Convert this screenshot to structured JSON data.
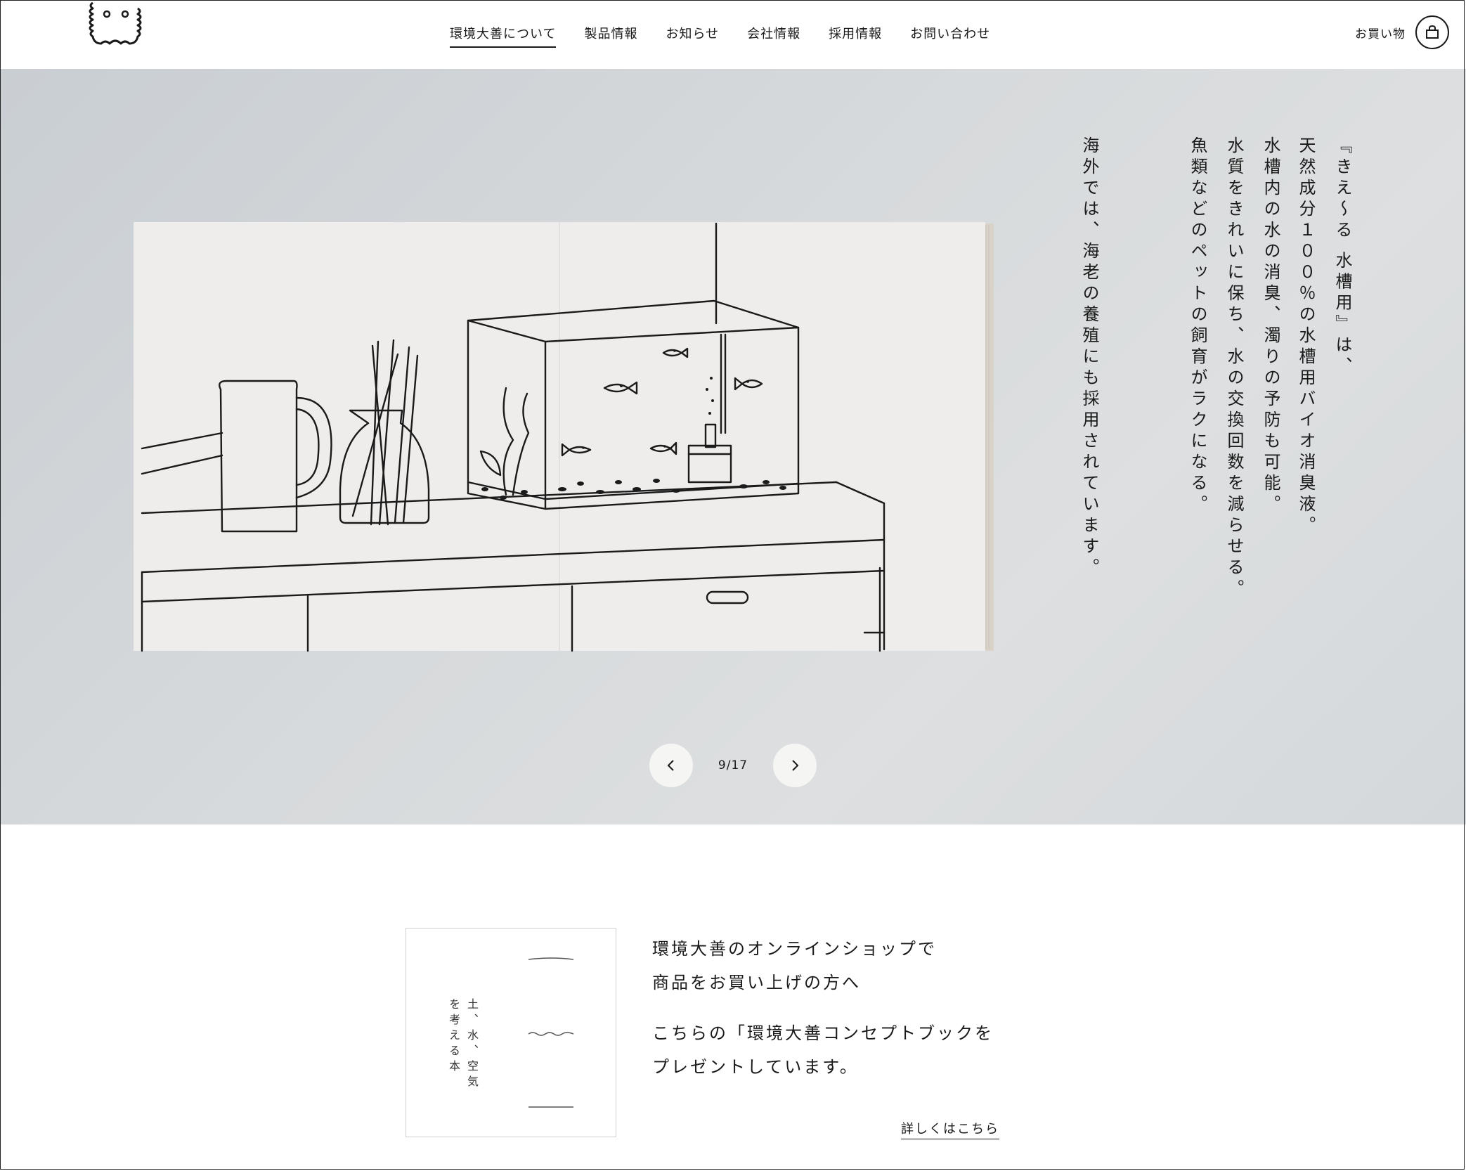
{
  "header": {
    "nav": [
      {
        "label": "環境大善について",
        "active": true
      },
      {
        "label": "製品情報"
      },
      {
        "label": "お知らせ"
      },
      {
        "label": "会社情報"
      },
      {
        "label": "採用情報"
      },
      {
        "label": "お問い合わせ"
      }
    ],
    "shop_label": "お買い物",
    "cart_icon": "shopping-bag-icon"
  },
  "hero": {
    "text_columns": [
      [
        "『きえ〜る 水槽用』は、",
        "天然成分１００％の水槽用バイオ消臭液。"
      ],
      [
        "水槽内の水の消臭、濁りの予防も可能。",
        "水質をきれいに保ち、水の交換回数を減らせる。",
        "魚類などのペットの飼育がラクになる。"
      ],
      [
        "海外では、海老の養殖にも採用されています。"
      ]
    ],
    "pager": {
      "current": 9,
      "total": 17,
      "text": "9/17",
      "prev_icon": "chevron-left-icon",
      "next_icon": "chevron-right-icon"
    }
  },
  "promo": {
    "cover_title_lines": [
      "土、水、空気",
      "を考える本"
    ],
    "lines_a": [
      "環境大善のオンラインショップで",
      "商品をお買い上げの方へ"
    ],
    "lines_b": [
      "こちらの「環境大善コンセプトブックを",
      "プレゼントしています。"
    ],
    "more_link": "詳しくはこちら"
  }
}
